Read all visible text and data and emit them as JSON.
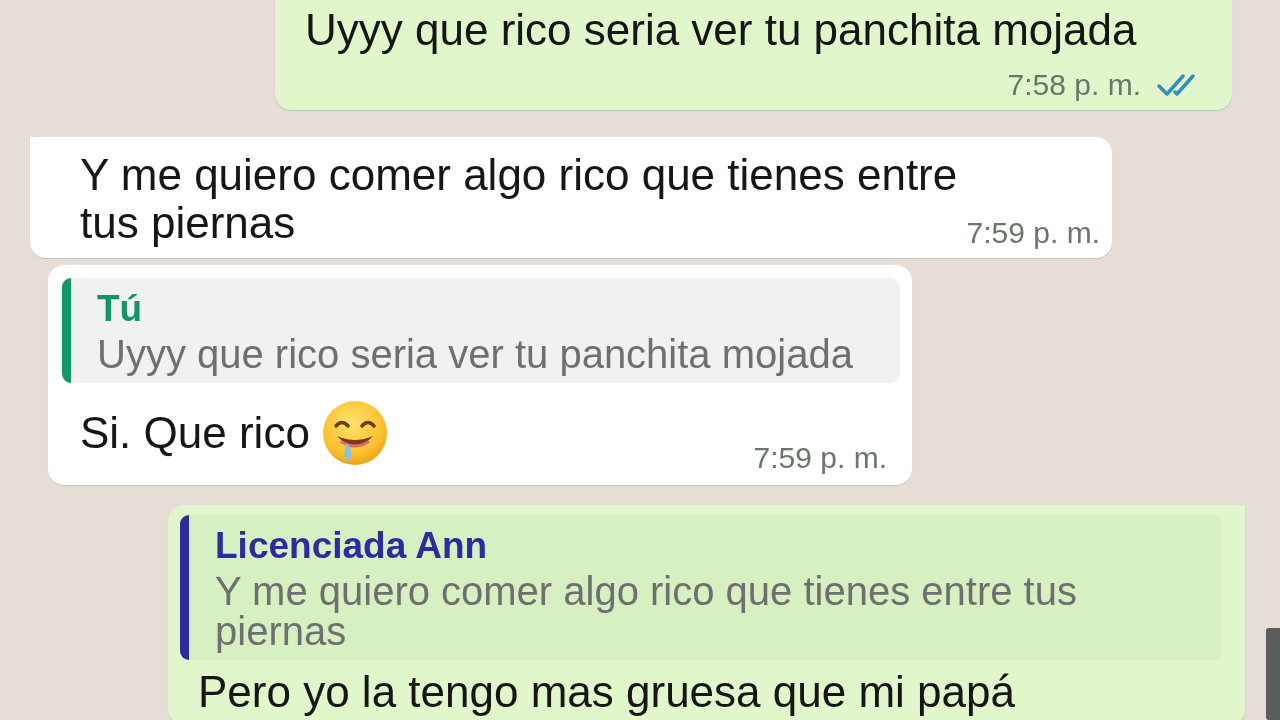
{
  "messages": [
    {
      "kind": "outgoing",
      "text": "Uyyy que rico seria ver tu panchita mojada",
      "time": "7:58 p. m.",
      "read": true
    },
    {
      "kind": "incoming",
      "text": "Y me quiero comer algo rico que tienes entre tus piernas",
      "time": "7:59 p. m."
    },
    {
      "kind": "incoming",
      "quote": {
        "author": "Tú",
        "text": "Uyyy que rico seria ver tu panchita mojada",
        "color": "#10966a"
      },
      "text": "Si. Que rico",
      "emoji": true,
      "time": "7:59 p. m."
    },
    {
      "kind": "outgoing",
      "quote": {
        "author": "Licenciada Ann",
        "text": "Y me quiero comer algo rico que tienes entre tus piernas",
        "color": "#2f2aa0"
      },
      "text": "Pero yo la tengo mas gruesa que mi papá"
    }
  ]
}
